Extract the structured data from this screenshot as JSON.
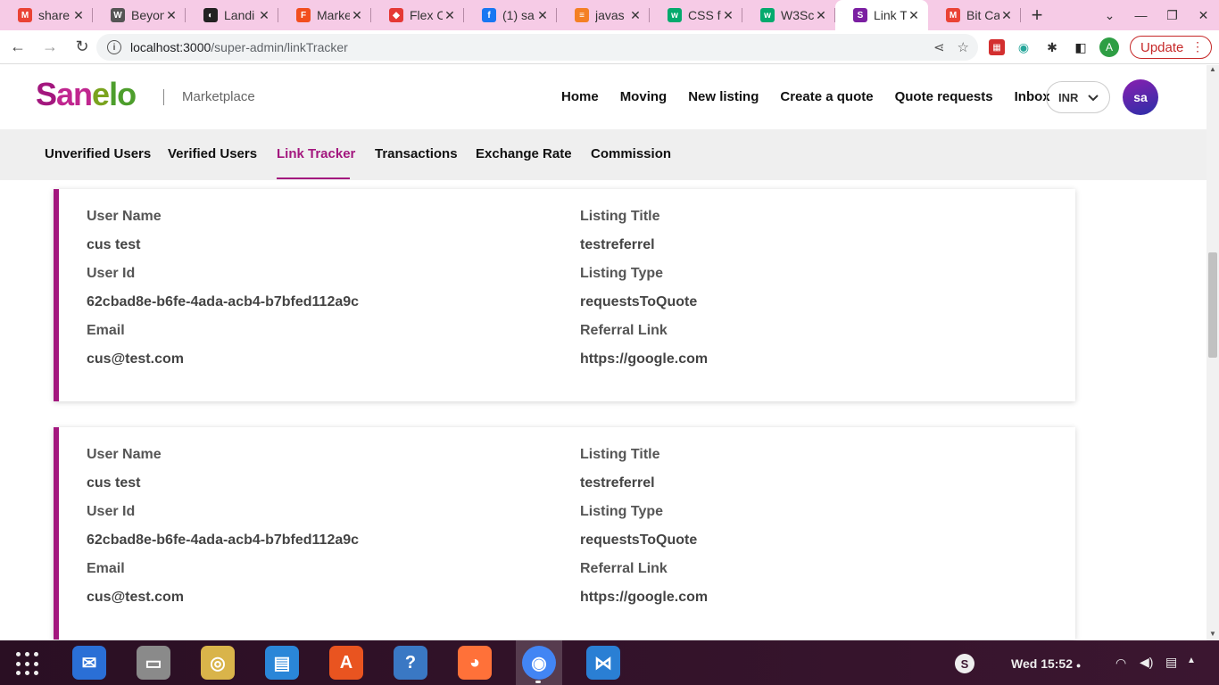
{
  "browser": {
    "tabs": [
      {
        "title": "share",
        "favicon": "gmail-icon",
        "color": "#ea4335"
      },
      {
        "title": "Beyon",
        "favicon": "w-icon",
        "color": "#555555"
      },
      {
        "title": "Landi",
        "favicon": "github-icon",
        "color": "#222222"
      },
      {
        "title": "Marke",
        "favicon": "figma-icon",
        "color": "#f24e1e"
      },
      {
        "title": "Flex C",
        "favicon": "ribbon-icon",
        "color": "#e53935"
      },
      {
        "title": "(1) sa",
        "favicon": "facebook-icon",
        "color": "#1877f2"
      },
      {
        "title": "javas",
        "favicon": "stackoverflow-icon",
        "color": "#f48024"
      },
      {
        "title": "CSS fl",
        "favicon": "w3-icon",
        "color": "#04aa6d"
      },
      {
        "title": "W3Sc",
        "favicon": "w3-icon",
        "color": "#04aa6d"
      },
      {
        "title": "Link T",
        "favicon": "sanelo-icon",
        "color": "#7b1fa2",
        "active": true
      },
      {
        "title": "Bit Ca",
        "favicon": "gmail-icon",
        "color": "#ea4335"
      }
    ],
    "url_host": "localhost:3000",
    "url_path": "/super-admin/linkTracker",
    "update_label": "Update"
  },
  "site": {
    "logo": {
      "part1": "S",
      "part2": "an",
      "part3": "e",
      "part4": "lo"
    },
    "marketplace": "Marketplace",
    "nav": [
      "Home",
      "Moving",
      "New listing",
      "Create a quote",
      "Quote requests",
      "Inbox"
    ],
    "currency": "INR",
    "avatar_initials": "sa",
    "brand_color": "#a3177e"
  },
  "admin_tabs": [
    {
      "label": "Unverified Users"
    },
    {
      "label": "Verified Users"
    },
    {
      "label": "Link Tracker",
      "active": true
    },
    {
      "label": "Transactions"
    },
    {
      "label": "Exchange Rate"
    },
    {
      "label": "Commission"
    }
  ],
  "labels": {
    "user_name": "User Name",
    "user_id": "User Id",
    "email": "Email",
    "listing_title": "Listing Title",
    "listing_type": "Listing Type",
    "referral_link": "Referral Link"
  },
  "records": [
    {
      "user_name": "cus test",
      "user_id": "62cbad8e-b6fe-4ada-acb4-b7bfed112a9c",
      "email": "cus@test.com",
      "listing_title": "testreferrel",
      "listing_type": "requestsToQuote",
      "referral_link": "https://google.com"
    },
    {
      "user_name": "cus test",
      "user_id": "62cbad8e-b6fe-4ada-acb4-b7bfed112a9c",
      "email": "cus@test.com",
      "listing_title": "testreferrel",
      "listing_type": "requestsToQuote",
      "referral_link": "https://google.com"
    }
  ],
  "taskbar": {
    "apps": [
      {
        "name": "thunderbird-icon",
        "color": "#2a6fd6"
      },
      {
        "name": "files-icon",
        "color": "#8a8a8a"
      },
      {
        "name": "rhythmbox-icon",
        "color": "#d9b44a"
      },
      {
        "name": "writer-icon",
        "color": "#2a86d8"
      },
      {
        "name": "software-center-icon",
        "color": "#e95420"
      },
      {
        "name": "help-icon",
        "color": "#3a78c4"
      },
      {
        "name": "firefox-icon",
        "color": "#ff7139"
      },
      {
        "name": "chrome-icon",
        "color": "#4285f4",
        "active": true
      },
      {
        "name": "vscode-icon",
        "color": "#2a7fd4"
      }
    ],
    "clock": "Wed 15:52"
  }
}
